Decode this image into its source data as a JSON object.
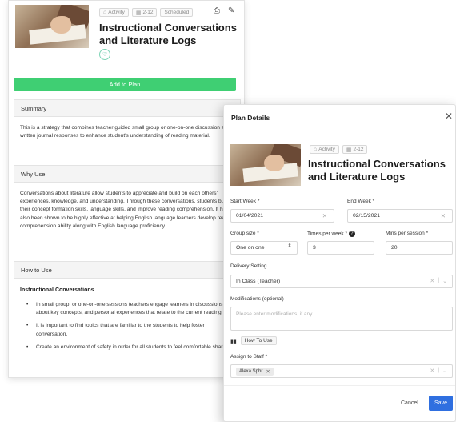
{
  "activity": {
    "tags": [
      {
        "icon": "activity-icon",
        "label": "Activity"
      },
      {
        "icon": "grade-icon",
        "label": "2-12"
      },
      {
        "icon": "",
        "label": "Scheduled"
      }
    ],
    "title": "Instructional Conversations and Literature Logs",
    "add_to_plan_label": "Add to Plan",
    "summary": {
      "header": "Summary",
      "text": "This is a strategy that combines teacher guided small group or one-on-one discussion and written journal responses to enhance student's understanding of reading material."
    },
    "why_use": {
      "header": "Why Use",
      "text": "Conversations about literature allow students to appreciate and build on each others' experiences, knowledge, and understanding. Through these conversations, students build their concept formation skills, language skills, and improve reading comprehension. It has also been shown to be highly effective at helping English language learners develop reading comprehension ability along with English language proficiency."
    },
    "how_to_use": {
      "header": "How to Use",
      "subheading": "Instructional Conversations",
      "bullets": [
        "In small group, or one-on-one sessions teachers engage learners in discussions about key concepts, and personal experiences that relate to the current reading.",
        "It is important to find topics that are familiar to the students to help foster conversation.",
        "Create an environment of safety in order for all students to feel comfortable sharing."
      ]
    }
  },
  "modal": {
    "title": "Plan Details",
    "tags": [
      {
        "icon": "activity-icon",
        "label": "Activity"
      },
      {
        "icon": "grade-icon",
        "label": "2-12"
      }
    ],
    "activity_title": "Instructional Conversations and Literature Logs",
    "start_week": {
      "label": "Start Week *",
      "value": "01/04/2021"
    },
    "end_week": {
      "label": "End Week *",
      "value": "02/15/2021"
    },
    "group_size": {
      "label": "Group size *",
      "value": "One on one"
    },
    "times_per_week": {
      "label": "Times per week *",
      "value": "3"
    },
    "mins_per_session": {
      "label": "Mins per session *",
      "value": "20"
    },
    "delivery_setting": {
      "label": "Delivery Setting",
      "value": "In Class (Teacher)"
    },
    "modifications": {
      "label": "Modifications (optional)",
      "placeholder": "Please enter modifications, if any"
    },
    "how_to_use_label": "How To Use",
    "assign_to_staff": {
      "label": "Assign to Staff *",
      "chips": [
        "Alexa Sphr"
      ]
    },
    "cancel_label": "Cancel",
    "save_label": "Save"
  },
  "colors": {
    "add_to_plan": "#3fcf73",
    "save_button": "#2f6fe0"
  }
}
